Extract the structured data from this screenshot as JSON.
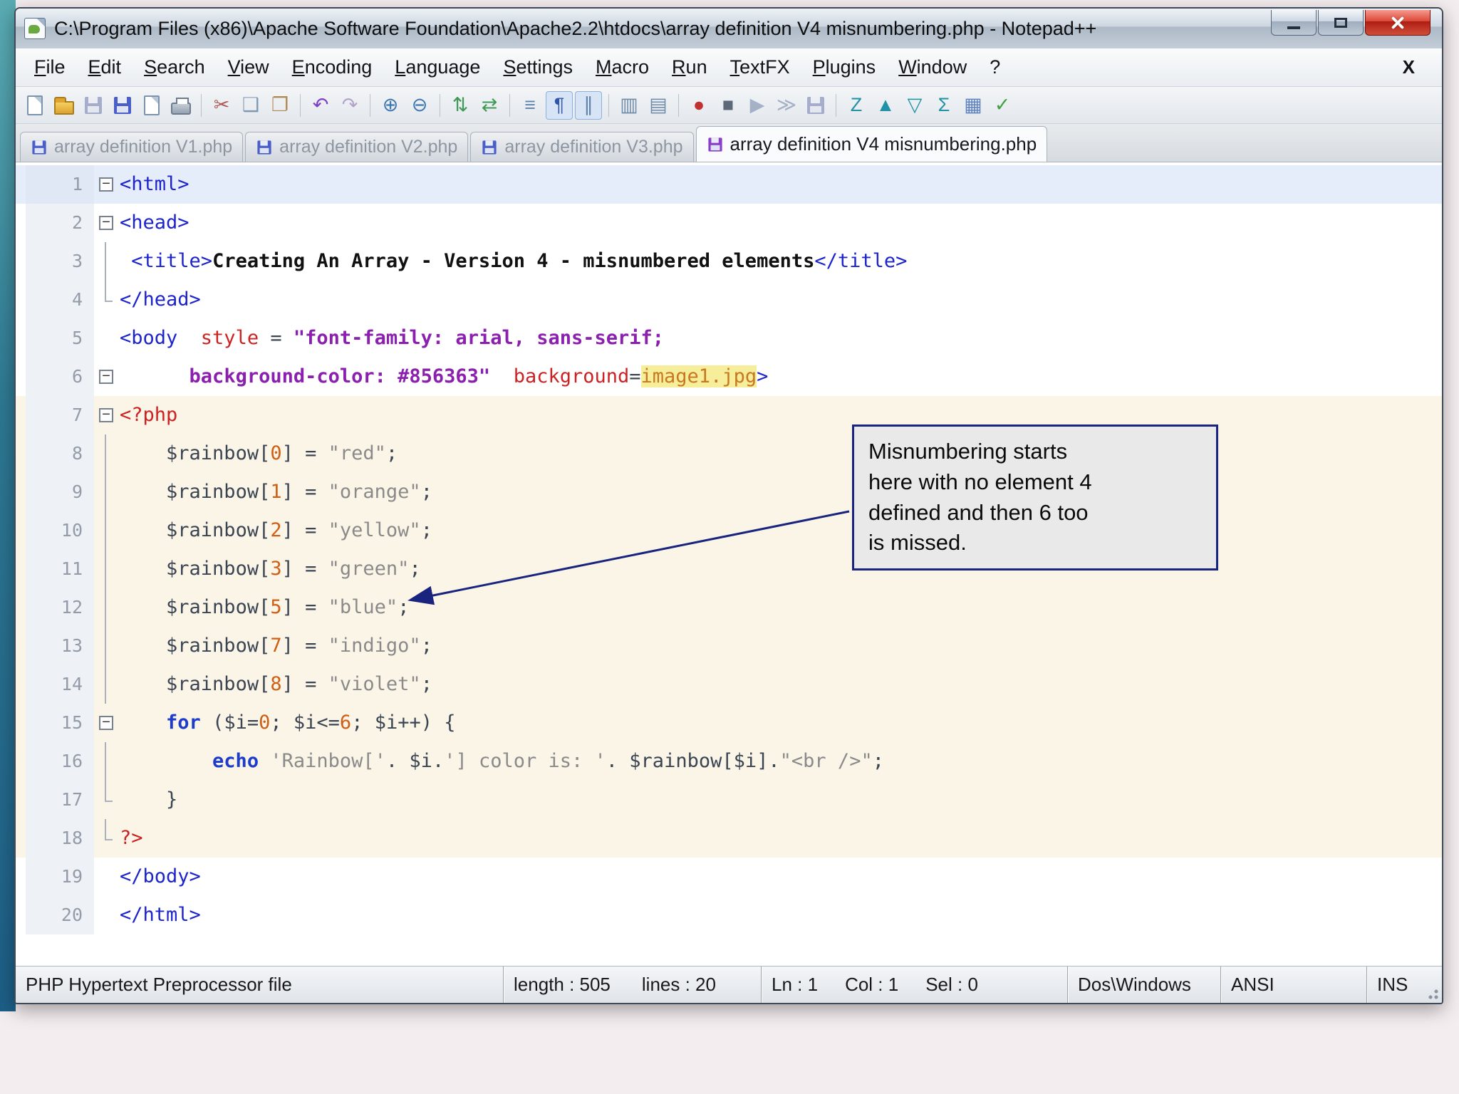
{
  "window": {
    "title": "C:\\Program Files (x86)\\Apache Software Foundation\\Apache2.2\\htdocs\\array definition V4 misnumbering.php - Notepad++"
  },
  "menu": {
    "items": [
      "File",
      "Edit",
      "Search",
      "View",
      "Encoding",
      "Language",
      "Settings",
      "Macro",
      "Run",
      "TextFX",
      "Plugins",
      "Window",
      "?"
    ],
    "close_label": "X"
  },
  "toolbar": {
    "groups": [
      [
        {
          "n": "new-file-icon",
          "cls": "ic-page"
        },
        {
          "n": "open-file-icon",
          "cls": "ic-folder"
        },
        {
          "n": "save-icon",
          "cls": "ic-floppy",
          "d": true
        },
        {
          "n": "save-all-icon",
          "cls": "ic-floppy"
        },
        {
          "n": "close-file-icon",
          "cls": "ic-page"
        },
        {
          "n": "print-icon",
          "cls": "ic-printer"
        }
      ],
      [
        {
          "n": "cut-icon",
          "g": "✂",
          "c": "#b05858"
        },
        {
          "n": "copy-icon",
          "g": "❑",
          "c": "#8099b3"
        },
        {
          "n": "paste-icon",
          "g": "❐",
          "c": "#b08a55"
        }
      ],
      [
        {
          "n": "undo-icon",
          "g": "↶",
          "c": "#7a3fc8"
        },
        {
          "n": "redo-icon",
          "g": "↷",
          "c": "#7a3fc8",
          "d": true
        }
      ],
      [
        {
          "n": "zoom-in-icon",
          "g": "⊕",
          "c": "#3f78b0"
        },
        {
          "n": "zoom-out-icon",
          "g": "⊖",
          "c": "#3f78b0"
        }
      ],
      [
        {
          "n": "sync-vertical-icon",
          "g": "⇅",
          "c": "#3f9a55"
        },
        {
          "n": "sync-horizontal-icon",
          "g": "⇄",
          "c": "#3f9a55"
        }
      ],
      [
        {
          "n": "word-wrap-icon",
          "g": "≡",
          "c": "#5f82ad"
        },
        {
          "n": "show-all-characters-icon",
          "g": "¶",
          "c": "#2f55a8",
          "p": true
        },
        {
          "n": "indent-guide-icon",
          "g": "∥",
          "c": "#5f82ad",
          "p": true
        }
      ],
      [
        {
          "n": "doc-switcher-icon",
          "g": "▥",
          "c": "#6d89a8"
        },
        {
          "n": "doc-map-icon",
          "g": "▤",
          "c": "#6d89a8"
        }
      ],
      [
        {
          "n": "record-macro-icon",
          "g": "●",
          "c": "#c23030"
        },
        {
          "n": "stop-recording-icon",
          "g": "■",
          "c": "#5d6878"
        },
        {
          "n": "playback-macro-icon",
          "g": "▶",
          "c": "#3f6ab0",
          "d": true
        },
        {
          "n": "run-macro-multiple-icon",
          "g": "≫",
          "c": "#3f6ab0",
          "d": true
        },
        {
          "n": "save-macro-icon",
          "cls": "ic-floppy",
          "d": true
        }
      ],
      [
        {
          "n": "textfx-sort-icon",
          "g": "Z",
          "c": "#1f93a5"
        },
        {
          "n": "textfx-up-icon",
          "g": "▲",
          "c": "#1f93a5"
        },
        {
          "n": "textfx-down-icon",
          "g": "▽",
          "c": "#1f93a5"
        },
        {
          "n": "textfx-sum-icon",
          "g": "Σ",
          "c": "#1f93a5"
        },
        {
          "n": "textfx-table-icon",
          "g": "▦",
          "c": "#5f82c0"
        },
        {
          "n": "spell-check-icon",
          "g": "✓",
          "c": "#3fa040"
        }
      ]
    ]
  },
  "tabs": [
    {
      "label": "array definition V1.php",
      "icon_color": "#4a5ec8",
      "active": false
    },
    {
      "label": "array definition V2.php",
      "icon_color": "#4a5ec8",
      "active": false
    },
    {
      "label": "array definition V3.php",
      "icon_color": "#4a5ec8",
      "active": false
    },
    {
      "label": "array definition V4 misnumbering.php",
      "icon_color": "#8a3fc8",
      "active": true
    }
  ],
  "editor": {
    "lines": [
      {
        "num": 1,
        "fold": "b",
        "cur": true,
        "php": false,
        "seg": [
          [
            "<html>",
            "tag"
          ]
        ]
      },
      {
        "num": 2,
        "fold": "b",
        "cur": false,
        "php": false,
        "seg": [
          [
            "<head>",
            "tag"
          ]
        ]
      },
      {
        "num": 3,
        "fold": "l",
        "cur": false,
        "php": false,
        "seg": [
          [
            " ",
            "pln"
          ],
          [
            "<title>",
            "tag"
          ],
          [
            "Creating An Array - Version 4 - misnumbered elements",
            "ttl"
          ],
          [
            "</title>",
            "tag"
          ]
        ]
      },
      {
        "num": 4,
        "fold": "e",
        "cur": false,
        "php": false,
        "seg": [
          [
            "</head>",
            "tag"
          ]
        ]
      },
      {
        "num": 5,
        "fold": "n",
        "cur": false,
        "php": false,
        "seg": [
          [
            "<body",
            "tag"
          ],
          [
            "  ",
            "pln"
          ],
          [
            "style",
            "attr"
          ],
          [
            " = ",
            "pln"
          ],
          [
            "\"font-family: arial, sans-serif;",
            "aval"
          ]
        ]
      },
      {
        "num": 6,
        "fold": "b",
        "cur": false,
        "php": false,
        "seg": [
          [
            "      ",
            "pln"
          ],
          [
            "background-color: #856363\"",
            "aval"
          ],
          [
            "  ",
            "pln"
          ],
          [
            "background",
            "attr"
          ],
          [
            "=",
            "pln"
          ],
          [
            "image1.jpg",
            "unq"
          ],
          [
            ">",
            "tag"
          ]
        ]
      },
      {
        "num": 7,
        "fold": "b",
        "cur": false,
        "php": true,
        "seg": [
          [
            "<?php",
            "php"
          ]
        ]
      },
      {
        "num": 8,
        "fold": "l",
        "cur": false,
        "php": true,
        "seg": [
          [
            "    ",
            "pln"
          ],
          [
            "$rainbow",
            "var"
          ],
          [
            "[",
            "pln"
          ],
          [
            "0",
            "num"
          ],
          [
            "] = ",
            "pln"
          ],
          [
            "\"red\"",
            "str"
          ],
          [
            ";",
            "pln"
          ]
        ]
      },
      {
        "num": 9,
        "fold": "l",
        "cur": false,
        "php": true,
        "seg": [
          [
            "    ",
            "pln"
          ],
          [
            "$rainbow",
            "var"
          ],
          [
            "[",
            "pln"
          ],
          [
            "1",
            "num"
          ],
          [
            "] = ",
            "pln"
          ],
          [
            "\"orange\"",
            "str"
          ],
          [
            ";",
            "pln"
          ]
        ]
      },
      {
        "num": 10,
        "fold": "l",
        "cur": false,
        "php": true,
        "seg": [
          [
            "    ",
            "pln"
          ],
          [
            "$rainbow",
            "var"
          ],
          [
            "[",
            "pln"
          ],
          [
            "2",
            "num"
          ],
          [
            "] = ",
            "pln"
          ],
          [
            "\"yellow\"",
            "str"
          ],
          [
            ";",
            "pln"
          ]
        ]
      },
      {
        "num": 11,
        "fold": "l",
        "cur": false,
        "php": true,
        "seg": [
          [
            "    ",
            "pln"
          ],
          [
            "$rainbow",
            "var"
          ],
          [
            "[",
            "pln"
          ],
          [
            "3",
            "num"
          ],
          [
            "] = ",
            "pln"
          ],
          [
            "\"green\"",
            "str"
          ],
          [
            ";",
            "pln"
          ]
        ]
      },
      {
        "num": 12,
        "fold": "l",
        "cur": false,
        "php": true,
        "seg": [
          [
            "    ",
            "pln"
          ],
          [
            "$rainbow",
            "var"
          ],
          [
            "[",
            "pln"
          ],
          [
            "5",
            "num"
          ],
          [
            "] = ",
            "pln"
          ],
          [
            "\"blue\"",
            "str"
          ],
          [
            ";",
            "pln"
          ]
        ]
      },
      {
        "num": 13,
        "fold": "l",
        "cur": false,
        "php": true,
        "seg": [
          [
            "    ",
            "pln"
          ],
          [
            "$rainbow",
            "var"
          ],
          [
            "[",
            "pln"
          ],
          [
            "7",
            "num"
          ],
          [
            "] = ",
            "pln"
          ],
          [
            "\"indigo\"",
            "str"
          ],
          [
            ";",
            "pln"
          ]
        ]
      },
      {
        "num": 14,
        "fold": "l",
        "cur": false,
        "php": true,
        "seg": [
          [
            "    ",
            "pln"
          ],
          [
            "$rainbow",
            "var"
          ],
          [
            "[",
            "pln"
          ],
          [
            "8",
            "num"
          ],
          [
            "] = ",
            "pln"
          ],
          [
            "\"violet\"",
            "str"
          ],
          [
            ";",
            "pln"
          ]
        ]
      },
      {
        "num": 15,
        "fold": "b",
        "cur": false,
        "php": true,
        "seg": [
          [
            "    ",
            "pln"
          ],
          [
            "for",
            "kw"
          ],
          [
            " (",
            "pln"
          ],
          [
            "$i",
            "var"
          ],
          [
            "=",
            "pln"
          ],
          [
            "0",
            "num"
          ],
          [
            "; ",
            "pln"
          ],
          [
            "$i",
            "var"
          ],
          [
            "<=",
            "pln"
          ],
          [
            "6",
            "num"
          ],
          [
            "; ",
            "pln"
          ],
          [
            "$i",
            "var"
          ],
          [
            "++) {",
            "pln"
          ]
        ]
      },
      {
        "num": 16,
        "fold": "l",
        "cur": false,
        "php": true,
        "seg": [
          [
            "        ",
            "pln"
          ],
          [
            "echo",
            "kw"
          ],
          [
            " ",
            "pln"
          ],
          [
            "'Rainbow['",
            "str"
          ],
          [
            ". ",
            "pln"
          ],
          [
            "$i",
            "var"
          ],
          [
            ".",
            "pln"
          ],
          [
            "'] color is: '",
            "str"
          ],
          [
            ". ",
            "pln"
          ],
          [
            "$rainbow",
            "var"
          ],
          [
            "[",
            "pln"
          ],
          [
            "$i",
            "var"
          ],
          [
            "]",
            "pln"
          ],
          [
            ".",
            "pln"
          ],
          [
            "\"<br />\"",
            "str"
          ],
          [
            ";",
            "pln"
          ]
        ]
      },
      {
        "num": 17,
        "fold": "e",
        "cur": false,
        "php": true,
        "seg": [
          [
            "    }",
            "pln"
          ]
        ]
      },
      {
        "num": 18,
        "fold": "e",
        "cur": false,
        "php": true,
        "seg": [
          [
            "?>",
            "php"
          ]
        ]
      },
      {
        "num": 19,
        "fold": "n",
        "cur": false,
        "php": false,
        "seg": [
          [
            "</body>",
            "tag"
          ]
        ]
      },
      {
        "num": 20,
        "fold": "n",
        "cur": false,
        "php": false,
        "seg": [
          [
            "</html>",
            "tag"
          ]
        ]
      }
    ]
  },
  "annotation": {
    "lines": [
      "Misnumbering starts",
      "here with no element 4",
      "defined and then 6 too",
      "is missed."
    ]
  },
  "status": {
    "doc_type": "PHP Hypertext Preprocessor file",
    "length": "length : 505",
    "lines": "lines : 20",
    "ln": "Ln : 1",
    "col": "Col : 1",
    "sel": "Sel : 0",
    "eol": "Dos\\Windows",
    "enc": "ANSI",
    "ins": "INS"
  }
}
